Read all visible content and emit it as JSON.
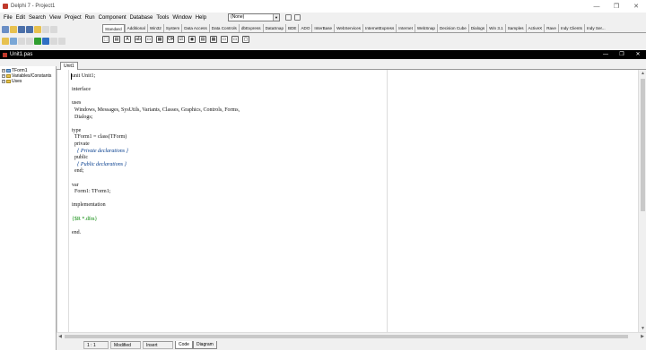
{
  "ide": {
    "window_title": "Delphi 7 - Project1",
    "menu": [
      "File",
      "Edit",
      "Search",
      "View",
      "Project",
      "Run",
      "Component",
      "Database",
      "Tools",
      "Window",
      "Help"
    ],
    "desktop_combo": "(None)",
    "palette_tabs": [
      "Standard",
      "Additional",
      "Win32",
      "System",
      "Data Access",
      "Data Controls",
      "dbExpress",
      "DataSnap",
      "BDE",
      "ADO",
      "InterBase",
      "WebServices",
      "InternetExpress",
      "Internet",
      "WebSnap",
      "Decision Cube",
      "Dialogs",
      "Win 3.1",
      "Samples",
      "ActiveX",
      "Rave",
      "Indy Clients",
      "Indy Ser..."
    ],
    "palette_icons": [
      "⬚",
      "▤",
      "A",
      "ab",
      "▭",
      "▦",
      "OK",
      "☑",
      "◉",
      "▤",
      "▦",
      "▭",
      "▭",
      "▢"
    ]
  },
  "editor": {
    "window_title": "Unit1.pas",
    "tab": "Unit1",
    "explorer": [
      {
        "label": "TForm1",
        "icon": "blue"
      },
      {
        "label": "Variables/Constants",
        "icon": "yellow"
      },
      {
        "label": "Uses",
        "icon": "yellow"
      }
    ],
    "code": [
      "unit Unit1;",
      "",
      "interface",
      "",
      "uses",
      "  Windows, Messages, SysUtils, Variants, Classes, Graphics, Controls, Forms,",
      "  Dialogs;",
      "",
      "type",
      "  TForm1 = class(TForm)",
      "  private",
      "    { Private declarations }",
      "  public",
      "    { Public declarations }",
      "  end;",
      "",
      "var",
      "  Form1: TForm1;",
      "",
      "implementation",
      "",
      "{$R *.dfm}",
      "",
      "end."
    ]
  },
  "status": {
    "position": "1 : 1",
    "modified": "Modified",
    "insert": "Insert",
    "tabs": [
      "Code",
      "Diagram"
    ]
  }
}
